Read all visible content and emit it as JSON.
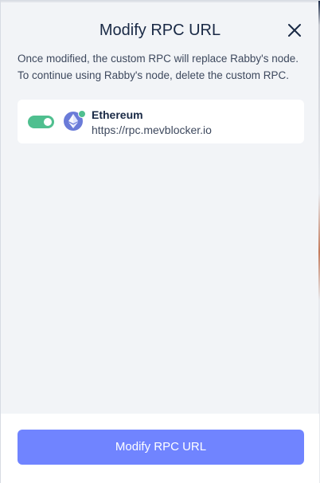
{
  "modal": {
    "title": "Modify RPC URL",
    "close_icon": "close-icon",
    "description_lines": [
      "Once modified, the custom RPC will replace Rabby's node.",
      "To continue using Rabby's node, delete the custom RPC."
    ]
  },
  "rpc_item": {
    "enabled": true,
    "chain_icon": "ethereum-logo-icon",
    "chain_name": "Ethereum",
    "url": "https://rpc.mevblocker.io"
  },
  "footer": {
    "button_label": "Modify RPC URL"
  },
  "colors": {
    "background": "#f2f4f7",
    "card": "#ffffff",
    "primary": "#7084ff",
    "toggle_on": "#4fbf8f",
    "eth_logo": "#6a7bd8",
    "text_primary": "#192945",
    "text_secondary": "#3e495e"
  }
}
